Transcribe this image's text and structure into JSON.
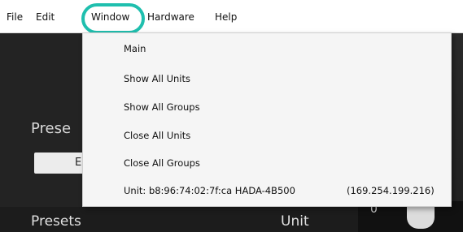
{
  "menubar": {
    "items": [
      "File",
      "Edit",
      "Window",
      "Hardware",
      "Help"
    ]
  },
  "window_menu": {
    "items": [
      "Main",
      "Show All Units",
      "Show All Groups",
      "Close All Units",
      "Close All Groups"
    ],
    "unit_entry": {
      "label": "Unit: b8:96:74:02:7f:ca HADA-4B500",
      "ip": "(169.254.199.216)"
    }
  },
  "background": {
    "presets_top": "Prese",
    "button_fragment": "E",
    "presets_bottom": "Presets",
    "unit_label": "Unit",
    "zero": "0"
  },
  "colors": {
    "highlight": "#1fbfae",
    "menu_bg": "#f5f5f5",
    "app_bg": "#202020"
  }
}
